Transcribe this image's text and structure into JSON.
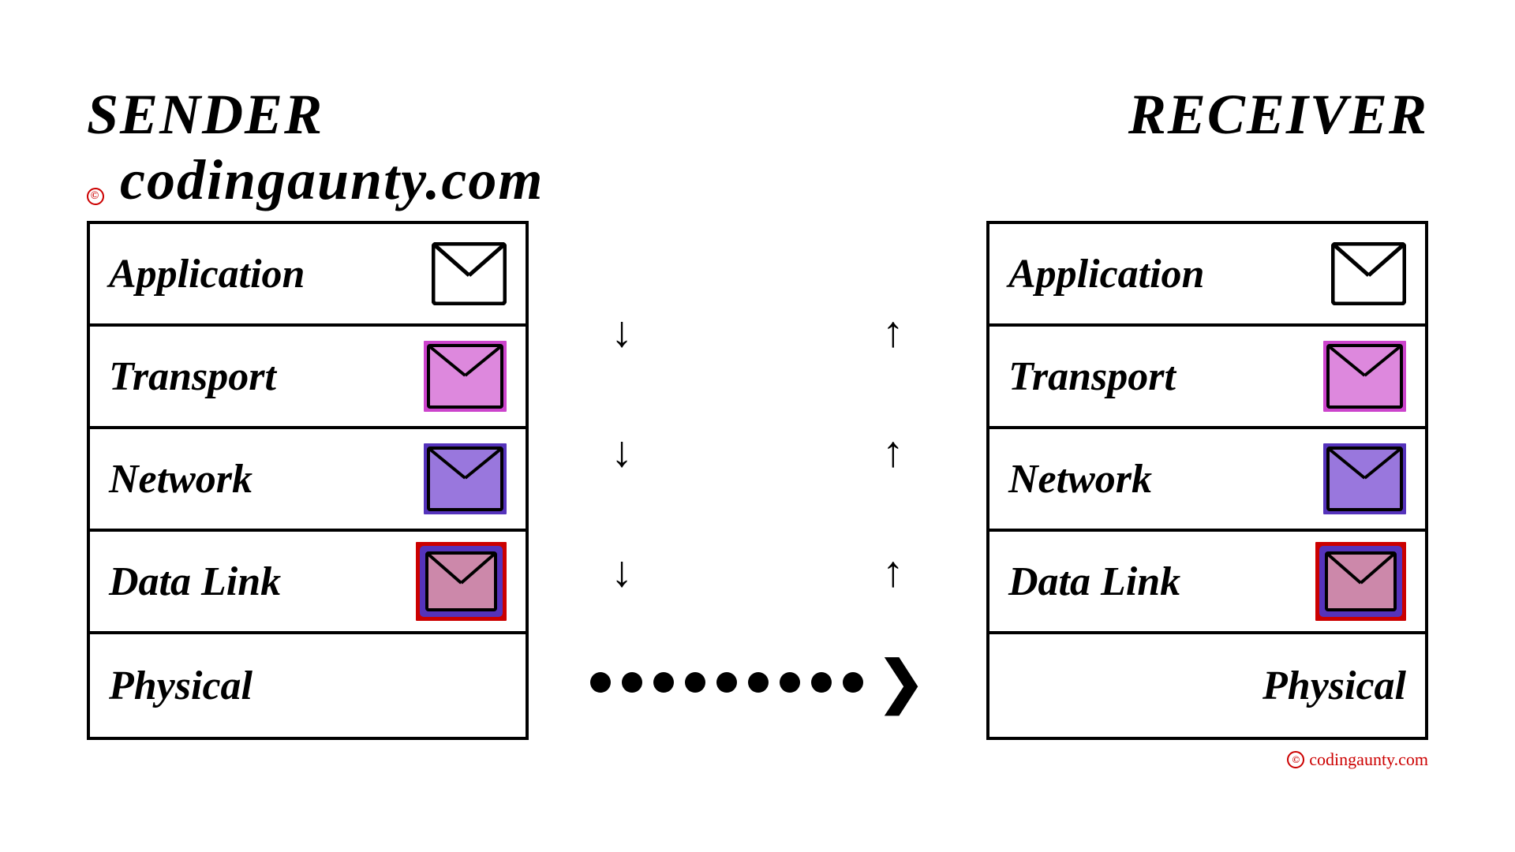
{
  "sender": {
    "title": "SENDER",
    "copyright": "codingaunty.com"
  },
  "receiver": {
    "title": "RECEIVER",
    "copyright": "codingaunty.com"
  },
  "layers": [
    {
      "id": "application",
      "label": "Application",
      "envelope_border": "black",
      "envelope_fill": "white"
    },
    {
      "id": "transport",
      "label": "Transport",
      "envelope_border": "purple",
      "envelope_fill": "violet"
    },
    {
      "id": "network",
      "label": "Network",
      "envelope_border": "blue",
      "envelope_fill": "mediumpurple"
    },
    {
      "id": "datalink",
      "label": "Data Link",
      "envelope_border": "red",
      "envelope_fill": "crimson"
    },
    {
      "id": "physical",
      "label": "Physical",
      "envelope_border": null,
      "envelope_fill": null
    }
  ],
  "down_arrows": [
    "↓",
    "↓",
    "↓"
  ],
  "up_arrows": [
    "↑",
    "↑",
    "↑"
  ],
  "dots_count": 9,
  "colors": {
    "background": "#ffffff",
    "border": "#000000",
    "application_env": "#ffffff",
    "transport_env": "#cc44cc",
    "network_env": "#6644cc",
    "datalink_env": "#cc0000",
    "arrow": "#000000",
    "title": "#000000",
    "copyright": "#cc0000"
  }
}
